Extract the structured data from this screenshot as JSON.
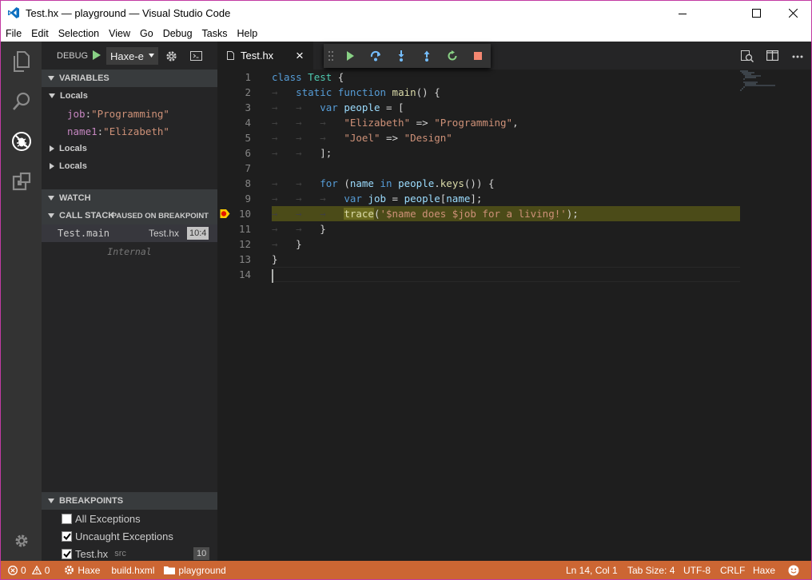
{
  "window": {
    "title": "Test.hx — playground — Visual Studio Code"
  },
  "menu": [
    "File",
    "Edit",
    "Selection",
    "View",
    "Go",
    "Debug",
    "Tasks",
    "Help"
  ],
  "debug": {
    "label": "DEBUG",
    "config": "Haxe-e"
  },
  "variables": {
    "header": "VARIABLES",
    "scopes": [
      {
        "name": "Locals",
        "expanded": true,
        "vars": [
          {
            "name": "job",
            "value": "\"Programming\""
          },
          {
            "name": "name1",
            "value": "\"Elizabeth\""
          }
        ]
      },
      {
        "name": "Locals",
        "expanded": false
      },
      {
        "name": "Locals",
        "expanded": false
      }
    ]
  },
  "watch": {
    "header": "WATCH"
  },
  "callstack": {
    "header": "CALL STACK",
    "status": "PAUSED ON BREAKPOINT",
    "frames": [
      {
        "name": "Test.main",
        "file": "Test.hx",
        "pos": "10:4"
      }
    ],
    "internal": "Internal"
  },
  "breakpoints": {
    "header": "BREAKPOINTS",
    "items": [
      {
        "label": "All Exceptions",
        "checked": false
      },
      {
        "label": "Uncaught Exceptions",
        "checked": true
      },
      {
        "label": "Test.hx",
        "detail": "src",
        "line": "10",
        "checked": true
      }
    ]
  },
  "tab": {
    "label": "Test.hx",
    "close": "×"
  },
  "line_numbers": [
    "1",
    "2",
    "3",
    "4",
    "5",
    "6",
    "7",
    "8",
    "9",
    "10",
    "11",
    "12",
    "13",
    "14"
  ],
  "status": {
    "errors": "0",
    "warnings": "0",
    "haxe": "Haxe",
    "build": "build.hxml",
    "folder": "playground",
    "position": "Ln 14, Col 1",
    "tabsize": "Tab Size: 4",
    "encoding": "UTF-8",
    "eol": "CRLF",
    "language": "Haxe"
  },
  "colors": {
    "statusbar": "#cc6633",
    "activity": "#333333",
    "sidebar": "#252526",
    "editor": "#1e1e1e",
    "highlight": "#4b4b18"
  }
}
